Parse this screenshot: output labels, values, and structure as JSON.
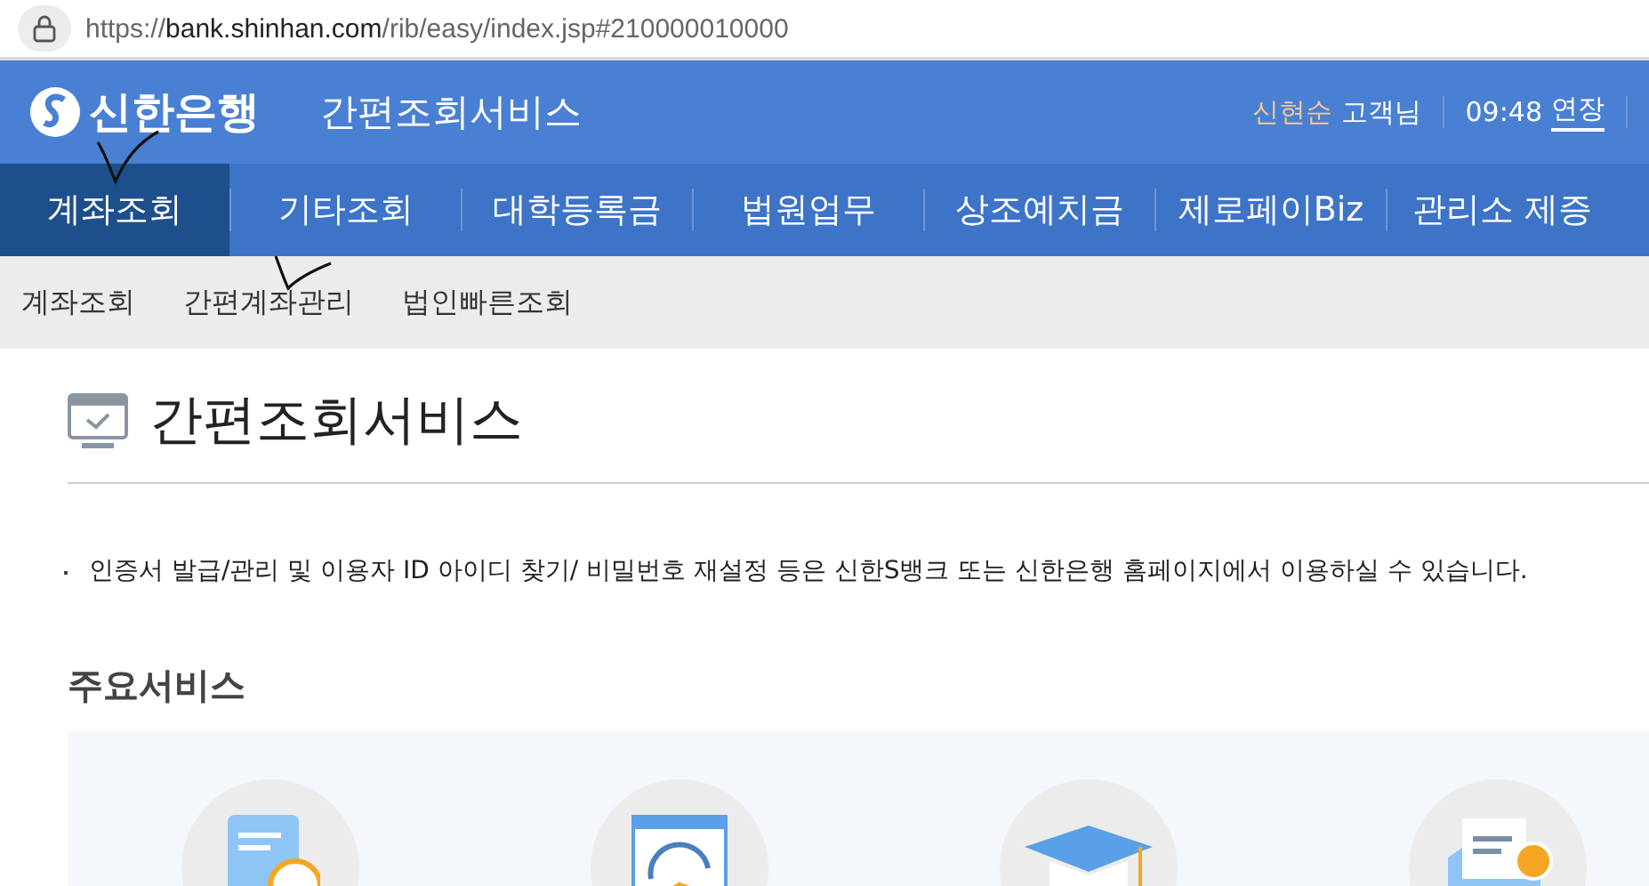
{
  "address_bar": {
    "url_host_prefix": "https://",
    "url_host": "bank.shinhan.com",
    "url_path": "/rib/easy/index.jsp#210000010000"
  },
  "header": {
    "logo_text": "신한은행",
    "service_title": "간편조회서비스",
    "user_name": "신현순",
    "user_suffix": "고객님",
    "timer": "09:48",
    "extend_link": "연장"
  },
  "main_nav": [
    {
      "label": "계좌조회",
      "selected": true
    },
    {
      "label": "기타조회",
      "selected": false
    },
    {
      "label": "대학등록금",
      "selected": false
    },
    {
      "label": "법원업무",
      "selected": false
    },
    {
      "label": "상조예치금",
      "selected": false
    },
    {
      "label": "제로페이Biz",
      "selected": false
    },
    {
      "label": "관리소 제증",
      "selected": false
    }
  ],
  "sub_nav": [
    {
      "label": "계좌조회"
    },
    {
      "label": "간편계좌관리"
    },
    {
      "label": "법인빠른조회"
    }
  ],
  "page_title": "간편조회서비스",
  "notice": "인증서 발급/관리 및 이용자 ID 아이디 찾기/ 비밀번호 재설정 등은 신한S뱅크 또는 신한은행 홈페이지에서 이용하실 수 있습니다.",
  "section_title": "주요서비스",
  "services": [
    {
      "kind": "document"
    },
    {
      "kind": "transfer"
    },
    {
      "kind": "graduation"
    },
    {
      "kind": "mail"
    }
  ]
}
